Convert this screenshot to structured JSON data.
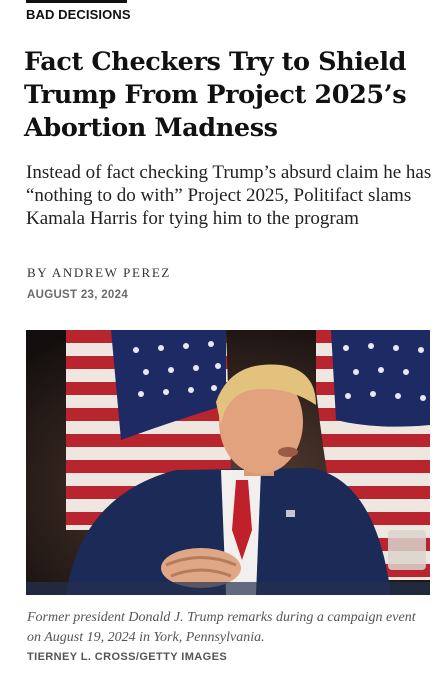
{
  "article": {
    "kicker": "BAD DECISIONS",
    "headline": "Fact Checkers Try to Shield Trump From Project 2025’s Abortion Madness",
    "dek": "Instead of fact checking Trump’s absurd claim he has “nothing to do with” Project 2025, Politifact slams Kamala Harris for tying him to the program",
    "byline": "BY ANDREW PEREZ",
    "date": "AUGUST 23, 2024"
  },
  "photo": {
    "caption": "Former president Donald J. Trump remarks during a campaign event on August 19, 2024 in York, Pennsylvania.",
    "credit": "TIERNEY L. CROSS/GETTY IMAGES"
  },
  "colors": {
    "flag_red": "#b8252f",
    "flag_blue": "#1d2a63",
    "suit_navy": "#1c2a57",
    "tie_red": "#c0202a"
  }
}
